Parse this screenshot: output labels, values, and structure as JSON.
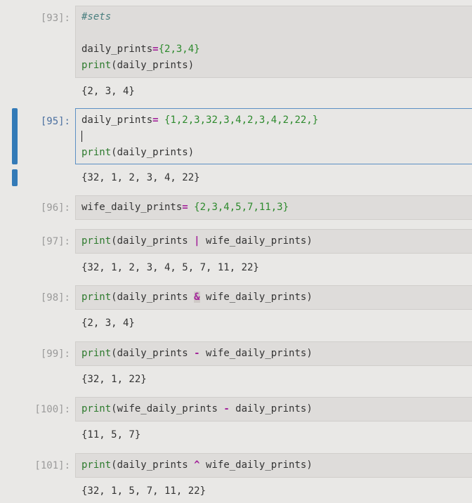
{
  "cells": [
    {
      "prompt": "[93]:",
      "lines": [
        {
          "comment": "#sets"
        },
        {
          "text": ""
        },
        {
          "name": "daily_prints",
          "eq": "=",
          "set": "{2,3,4}"
        },
        {
          "print_fn": "print",
          "args": "(daily_prints)"
        }
      ],
      "output": "{2, 3, 4}"
    },
    {
      "prompt": "[95]:",
      "lines": [
        {
          "name": "daily_prints",
          "eq": "= ",
          "set": "{1,2,3,32,3,4,2,3,4,2,22,}"
        },
        {
          "text": ""
        },
        {
          "print_fn": "print",
          "args": "(daily_prints)"
        }
      ],
      "output": "{32, 1, 2, 3, 4, 22}"
    },
    {
      "prompt": "[96]:",
      "lines": [
        {
          "name": "wife_daily_prints",
          "eq": "= ",
          "set": "{2,3,4,5,7,11,3}"
        }
      ],
      "output": ""
    },
    {
      "prompt": "[97]:",
      "print_fn": "print",
      "left": "(daily_prints ",
      "op": "|",
      "right": " wife_daily_prints)",
      "output": "{32, 1, 2, 3, 4, 5, 7, 11, 22}"
    },
    {
      "prompt": "[98]:",
      "print_fn": "print",
      "left": "(daily_prints ",
      "op": "&",
      "right": " wife_daily_prints)",
      "output": "{2, 3, 4}"
    },
    {
      "prompt": "[99]:",
      "print_fn": "print",
      "left": "(daily_prints ",
      "op": "-",
      "right": " wife_daily_prints)",
      "output": "{32, 1, 22}"
    },
    {
      "prompt": "[100]:",
      "print_fn": "print",
      "left": "(wife_daily_prints ",
      "op": "-",
      "right": " daily_prints)",
      "output": "{11, 5, 7}"
    },
    {
      "prompt": "[101]:",
      "print_fn": "print",
      "left": "(daily_prints ",
      "op": "^",
      "right": " wife_daily_prints)",
      "output": "{32, 1, 5, 7, 11, 22}"
    }
  ],
  "colors": {
    "selection_bar": "#337ab7",
    "selected_border": "#5b8fc4",
    "keyword_print": "#2d7a2d",
    "operator": "#a3249a",
    "comment": "#4a7f7f"
  }
}
